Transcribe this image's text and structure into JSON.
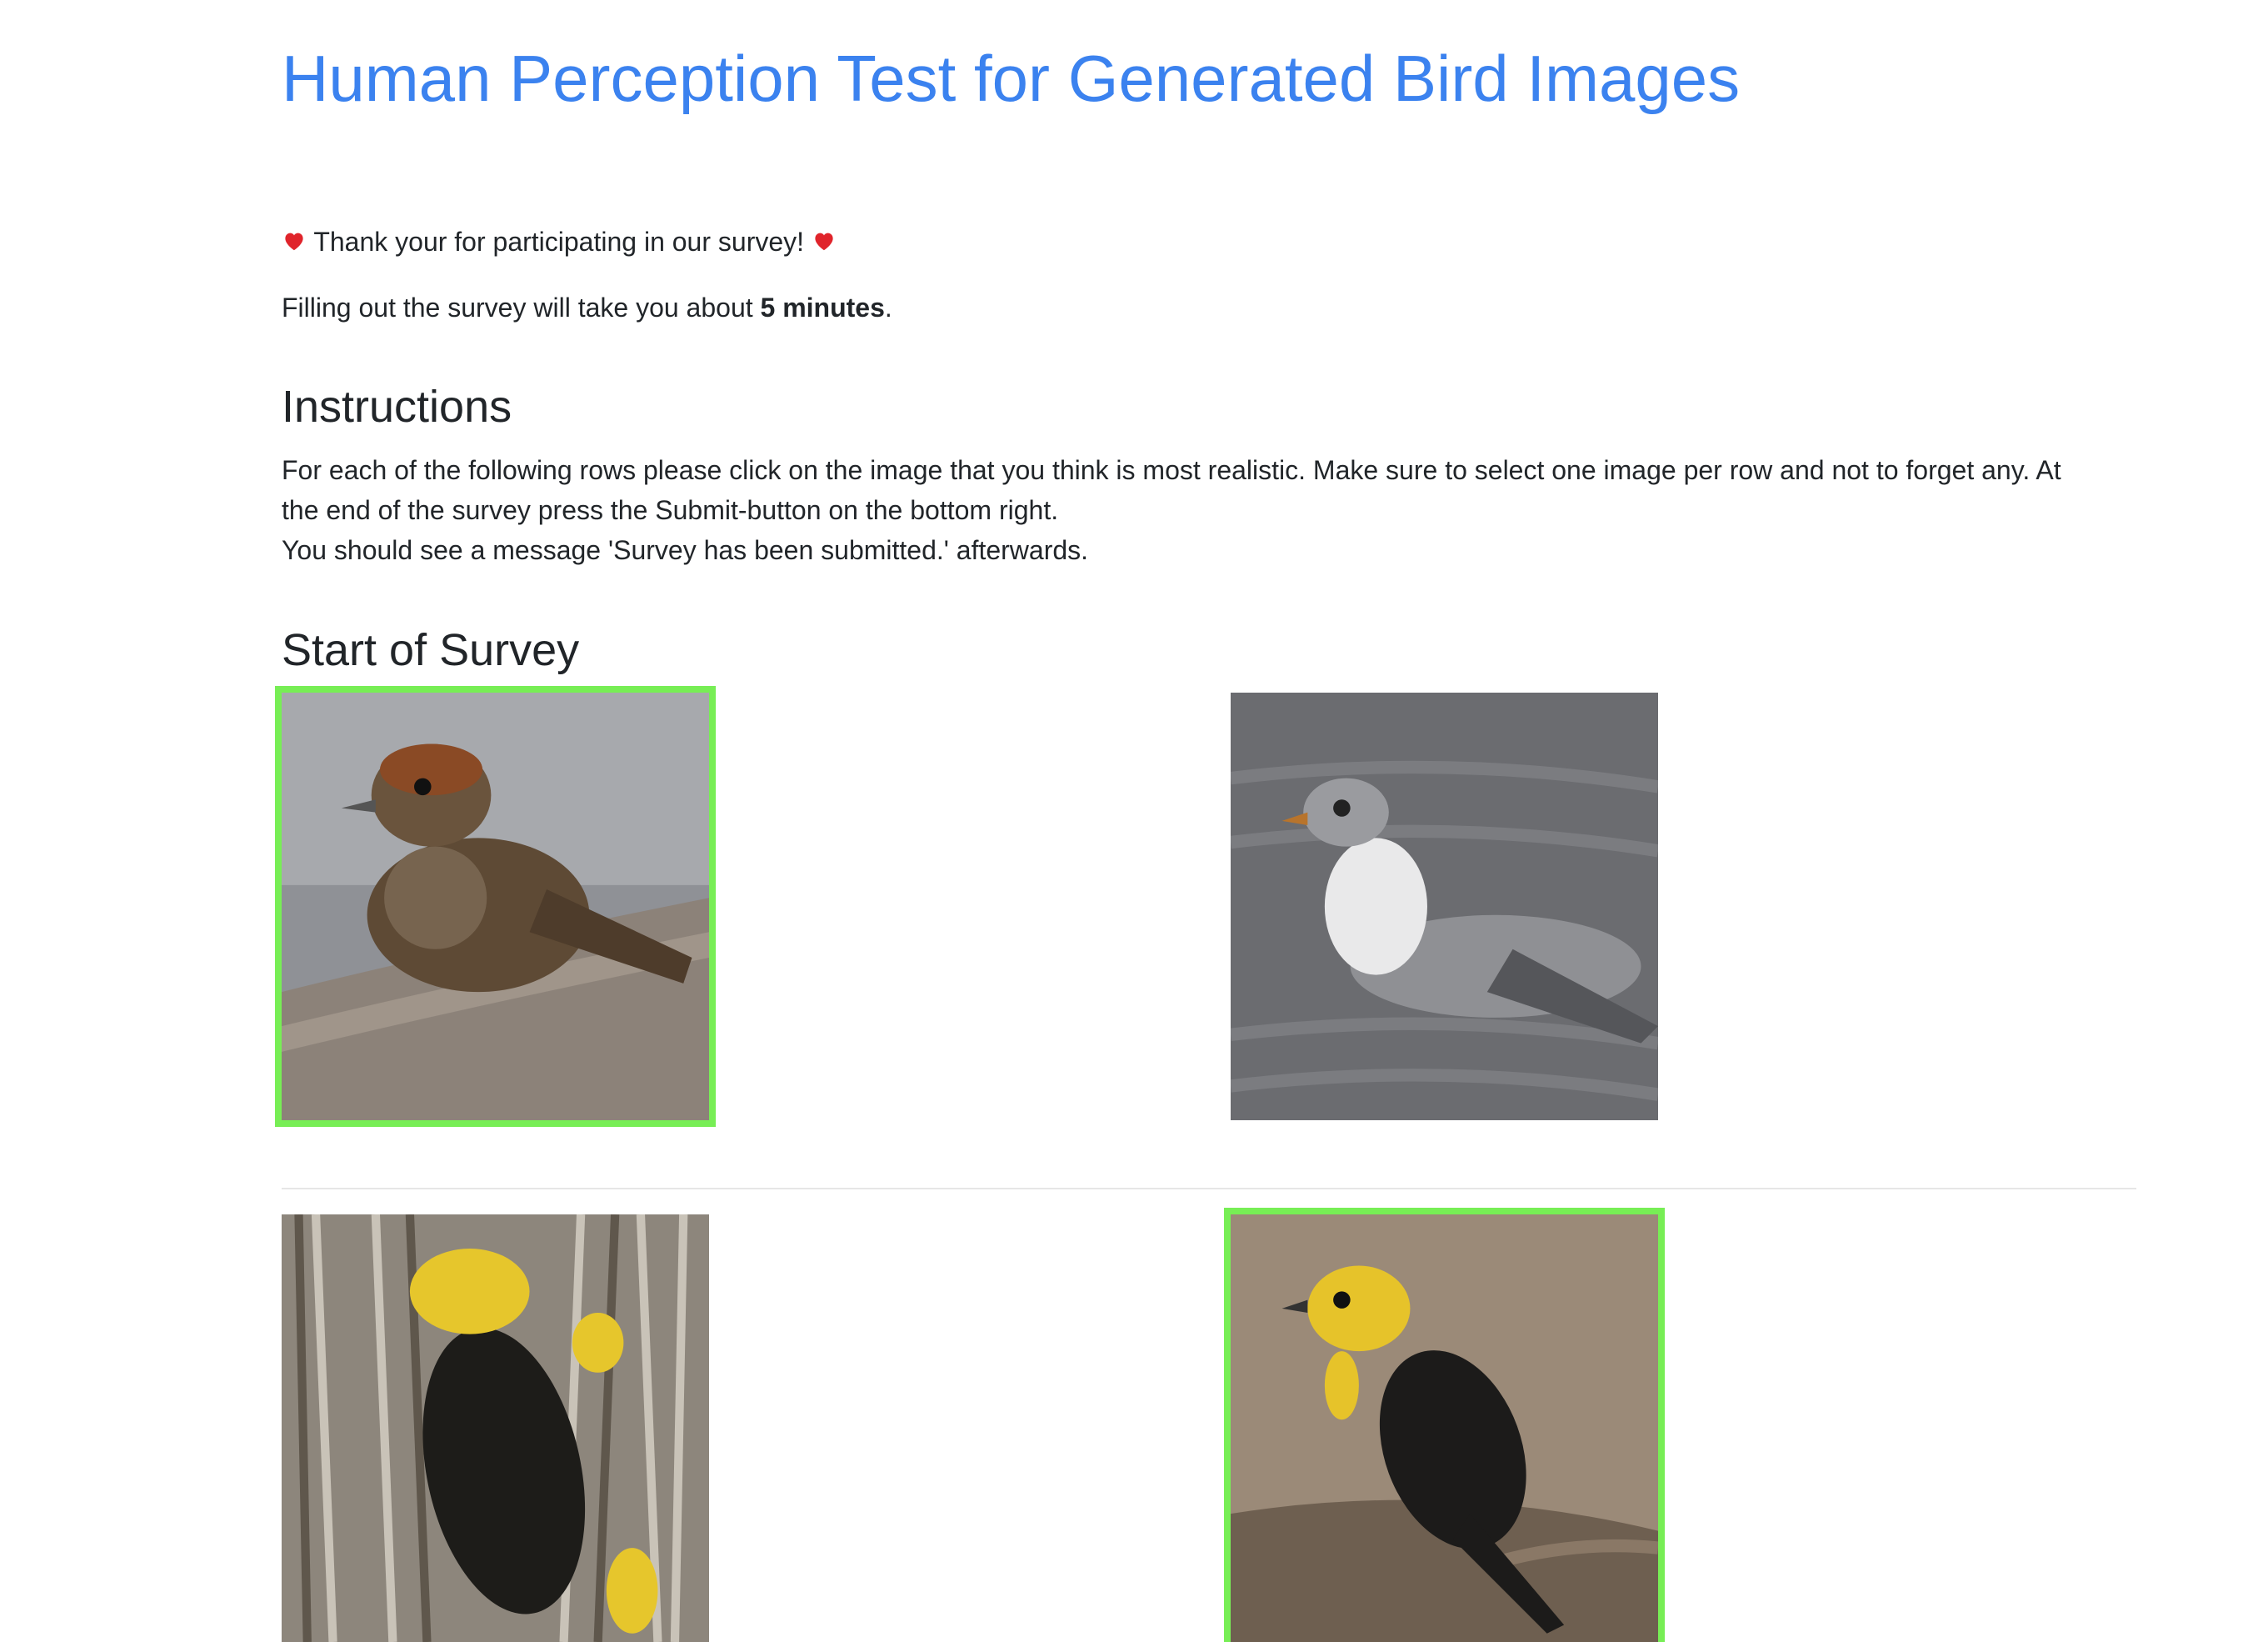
{
  "title": "Human Perception Test for Generated Bird Images",
  "intro": {
    "thanks": "Thank your for participating in our survey!",
    "duration_prefix": "Filling out the survey will take you about",
    "duration_bold": "5 minutes",
    "duration_suffix": "."
  },
  "instructions": {
    "heading": "Instructions",
    "line1": "For each of the following rows please click on the image that you think is most realistic. Make sure to select one image per row and not to forget any. At",
    "line2": "the end of the survey press the Submit-button on the bottom right.",
    "line3": "You should see a message 'Survey has been submitted.' afterwards."
  },
  "survey": {
    "heading": "Start of Survey",
    "rows": [
      {
        "images": [
          {
            "subject": "brown-sparrow-on-branch",
            "selected": true
          },
          {
            "subject": "gray-gull-on-water",
            "selected": false
          }
        ]
      },
      {
        "images": [
          {
            "subject": "yellow-headed-blackbird-in-reeds",
            "selected": false
          },
          {
            "subject": "yellow-headed-blackbird-on-log",
            "selected": true
          }
        ]
      }
    ]
  },
  "colors": {
    "accent": "#3b82ef",
    "selection": "#77ee55",
    "heart": "#e0242b"
  }
}
